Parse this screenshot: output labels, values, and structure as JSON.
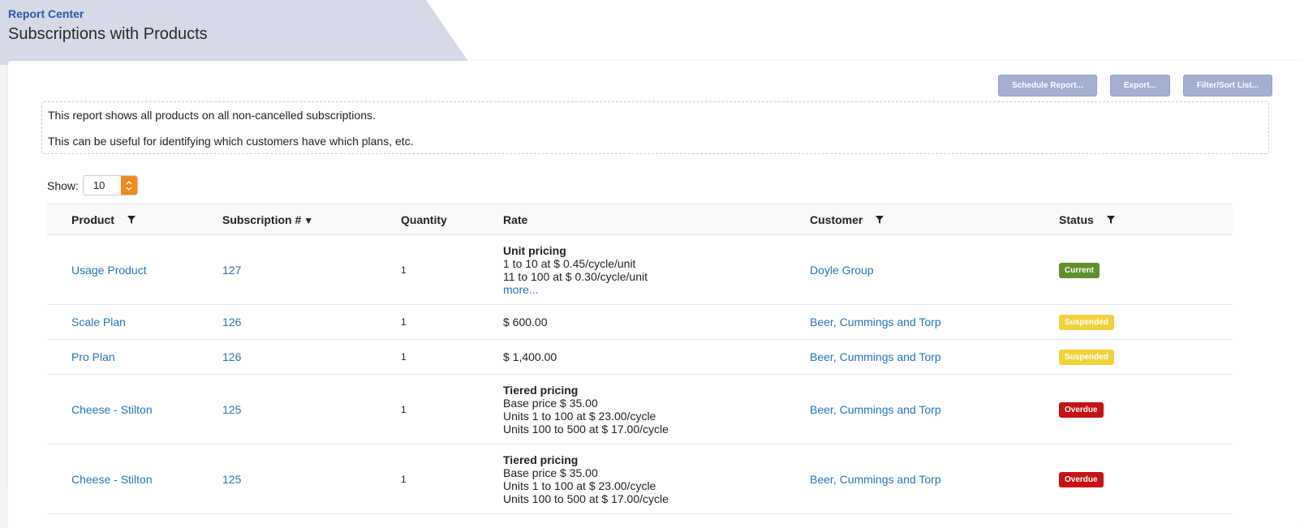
{
  "header": {
    "section": "Report Center",
    "title": "Subscriptions with Products"
  },
  "toolbar": {
    "schedule_label": "Schedule Report...",
    "export_label": "Export...",
    "filter_label": "Filter/Sort List..."
  },
  "description": {
    "line1": "This report shows all products on all non-cancelled subscriptions.",
    "line2": "This can be useful for identifying which customers have which plans, etc."
  },
  "show": {
    "label": "Show:",
    "value": "10"
  },
  "table": {
    "columns": {
      "product": "Product",
      "subscription": "Subscription #",
      "quantity": "Quantity",
      "rate": "Rate",
      "customer": "Customer",
      "status": "Status"
    },
    "rows": [
      {
        "product": "Usage Product",
        "subscription": "127",
        "quantity": "1",
        "rate_title": "Unit pricing",
        "rate_lines": [
          "1 to 10 at $ 0.45/cycle/unit",
          "11 to 100 at $ 0.30/cycle/unit"
        ],
        "rate_more": "more...",
        "customer": "Doyle Group",
        "status": "Current"
      },
      {
        "product": "Scale Plan",
        "subscription": "126",
        "quantity": "1",
        "rate_plain": "$ 600.00",
        "customer": "Beer, Cummings and Torp",
        "status": "Suspended"
      },
      {
        "product": "Pro Plan",
        "subscription": "126",
        "quantity": "1",
        "rate_plain": "$ 1,400.00",
        "customer": "Beer, Cummings and Torp",
        "status": "Suspended"
      },
      {
        "product": "Cheese - Stilton",
        "subscription": "125",
        "quantity": "1",
        "rate_title": "Tiered pricing",
        "rate_lines": [
          "Base price $ 35.00",
          "Units 1 to 100 at $ 23.00/cycle",
          "Units 100 to 500 at $ 17.00/cycle"
        ],
        "customer": "Beer, Cummings and Torp",
        "status": "Overdue"
      },
      {
        "product": "Cheese - Stilton",
        "subscription": "125",
        "quantity": "1",
        "rate_title": "Tiered pricing",
        "rate_lines": [
          "Base price $ 35.00",
          "Units 1 to 100 at $ 23.00/cycle",
          "Units 100 to 500 at $ 17.00/cycle"
        ],
        "customer": "Beer, Cummings and Torp",
        "status": "Overdue"
      }
    ]
  },
  "colors": {
    "link": "#2474c4",
    "current": "#5f8f2e",
    "suspended": "#f0d23c",
    "overdue": "#c81212",
    "toolbar_button": "#a3aed0",
    "stepper": "#f08a1c"
  }
}
